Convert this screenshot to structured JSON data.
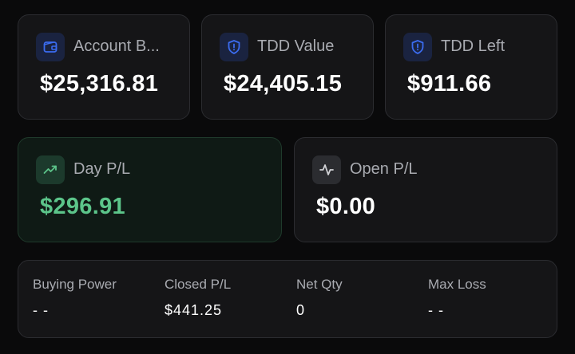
{
  "cards_top": [
    {
      "label": "Account B...",
      "value": "$25,316.81",
      "icon": "wallet-icon"
    },
    {
      "label": "TDD Value",
      "value": "$24,405.15",
      "icon": "shield-alert-icon"
    },
    {
      "label": "TDD Left",
      "value": "$911.66",
      "icon": "shield-alert-icon"
    }
  ],
  "day_pl": {
    "label": "Day P/L",
    "value": "$296.91",
    "icon": "trending-up-icon"
  },
  "open_pl": {
    "label": "Open P/L",
    "value": "$0.00",
    "icon": "activity-icon"
  },
  "stats": [
    {
      "label": "Buying Power",
      "value": "- -"
    },
    {
      "label": "Closed P/L",
      "value": "$441.25"
    },
    {
      "label": "Net Qty",
      "value": "0"
    },
    {
      "label": "Max Loss",
      "value": "- -"
    }
  ],
  "colors": {
    "background": "#0a0a0b",
    "card": "#151517",
    "border": "#2b2c30",
    "accent_blue": "#3b6cf0",
    "positive_green": "#5cc58a",
    "muted_text": "#a9abb1"
  }
}
